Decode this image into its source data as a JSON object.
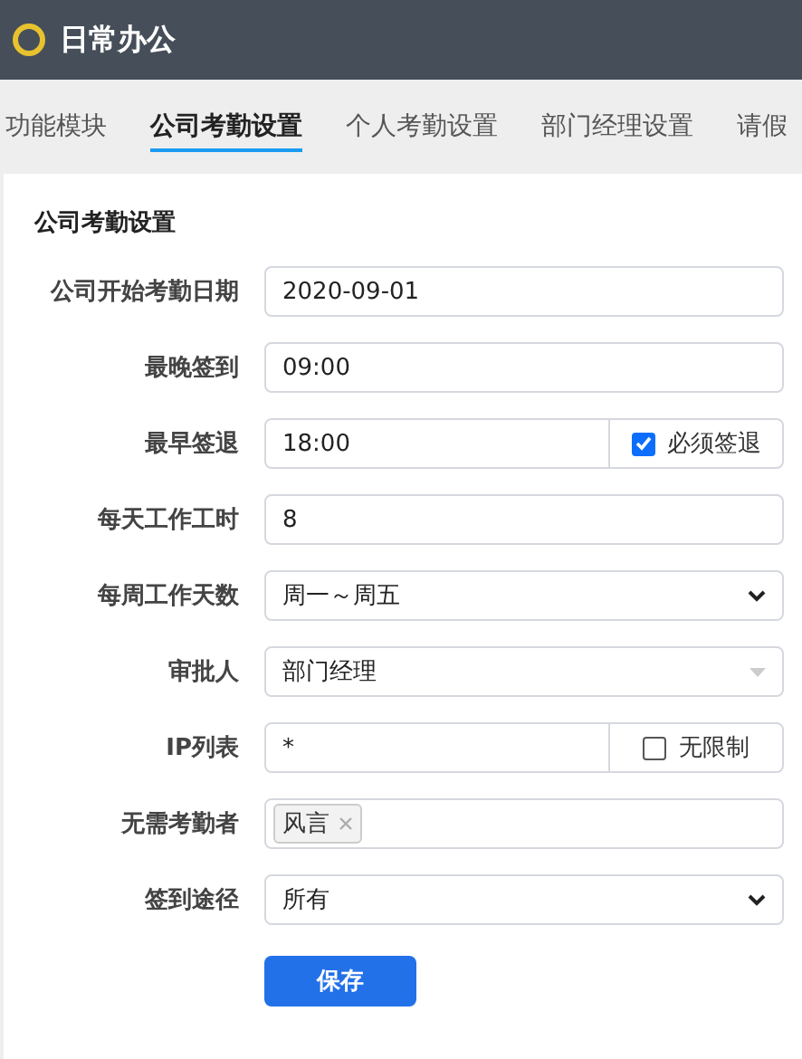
{
  "header": {
    "title": "日常办公"
  },
  "tabs": [
    {
      "label": "功能模块",
      "selected": false
    },
    {
      "label": "公司考勤设置",
      "selected": true
    },
    {
      "label": "个人考勤设置",
      "selected": false
    },
    {
      "label": "部门经理设置",
      "selected": false
    },
    {
      "label": "请假",
      "selected": false
    }
  ],
  "form": {
    "title": "公司考勤设置",
    "rows": [
      {
        "label": "公司开始考勤日期",
        "kind": "text",
        "value": "2020-09-01"
      },
      {
        "label": "最晚签到",
        "kind": "text",
        "value": "09:00"
      },
      {
        "label": "最早签退",
        "kind": "addon",
        "value": "18:00",
        "checkbox": {
          "label": "必须签退",
          "checked": true
        }
      },
      {
        "label": "每天工作工时",
        "kind": "text",
        "value": "8"
      },
      {
        "label": "每周工作天数",
        "kind": "select",
        "value": "周一～周五"
      },
      {
        "label": "审批人",
        "kind": "combo",
        "value": "部门经理"
      },
      {
        "label": "IP列表",
        "kind": "addon",
        "value": "*",
        "checkbox": {
          "label": "无限制",
          "checked": false
        }
      },
      {
        "label": "无需考勤者",
        "kind": "tags",
        "tags": [
          "风言"
        ]
      },
      {
        "label": "签到途径",
        "kind": "select",
        "value": "所有"
      }
    ],
    "submit": "保存"
  }
}
